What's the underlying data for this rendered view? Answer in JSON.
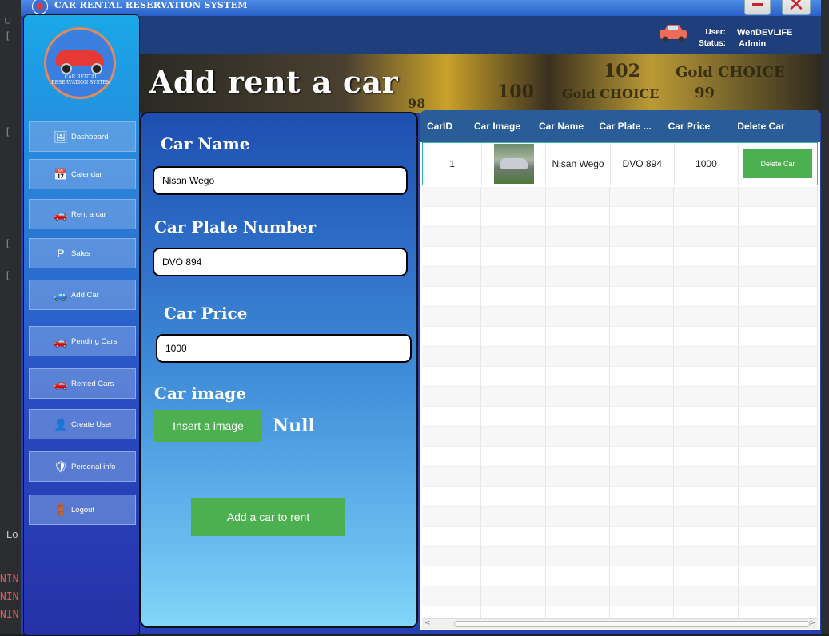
{
  "window": {
    "title": "CAR RENTAL RESERVATION SYSTEM",
    "close_glyph": "✕"
  },
  "logo": {
    "text": "CAR RENTAL RESERVATION SYSTEM"
  },
  "sidebar": {
    "items": [
      {
        "label": "Dashboard",
        "icon": "dashboard-icon",
        "glyph": "🖼"
      },
      {
        "label": "Calendar",
        "icon": "calendar-icon",
        "glyph": "📅"
      },
      {
        "label": "Rent a car",
        "icon": "car-icon",
        "glyph": "🚗"
      },
      {
        "label": "Sales",
        "icon": "paypal-icon",
        "glyph": "P"
      },
      {
        "label": "Add Car",
        "icon": "add-car-icon",
        "glyph": "🚙"
      },
      {
        "label": "Pending Cars",
        "icon": "car-icon",
        "glyph": "🚗"
      },
      {
        "label": "Rented Cars",
        "icon": "car-icon",
        "glyph": "🚗"
      },
      {
        "label": "Create User",
        "icon": "add-user-icon",
        "glyph": "👤"
      },
      {
        "label": "Personal info",
        "icon": "shield-user-icon",
        "glyph": "🛡"
      },
      {
        "label": "Logout",
        "icon": "logout-icon",
        "glyph": "🚪"
      }
    ]
  },
  "header": {
    "user_label": "User:",
    "status_label": "Status:",
    "user_value": "WenDEVLIFE",
    "status_value": "Admin"
  },
  "banner": {
    "title": "Add rent a car",
    "deco": [
      "102",
      "Gold CHOICE",
      "100",
      "Gold CHOICE",
      "99",
      "98"
    ]
  },
  "form": {
    "car_name_label": "Car Name",
    "car_name_value": "Nisan Wego",
    "plate_label": "Car Plate Number",
    "plate_value": "DVO 894",
    "price_label": "Car Price",
    "price_value": "1000",
    "image_label": "Car image",
    "insert_image_label": "Insert a image",
    "image_status": "Null",
    "submit_label": "Add a car to rent"
  },
  "table": {
    "columns": [
      "CarID",
      "Car Image",
      "Car Name",
      "Car Plate ...",
      "Car Price",
      "Delete Car"
    ],
    "rows": [
      {
        "id": "1",
        "name": "Nisan Wego",
        "plate": "DVO 894",
        "price": "1000",
        "action": "Delete Car"
      }
    ]
  },
  "ide": {
    "log_label": "Lo",
    "nin": "NIN"
  },
  "colors": {
    "accent_green": "#4caf50",
    "header_blue": "#2a5d97",
    "sidebar_top": "#1aa8e8"
  }
}
